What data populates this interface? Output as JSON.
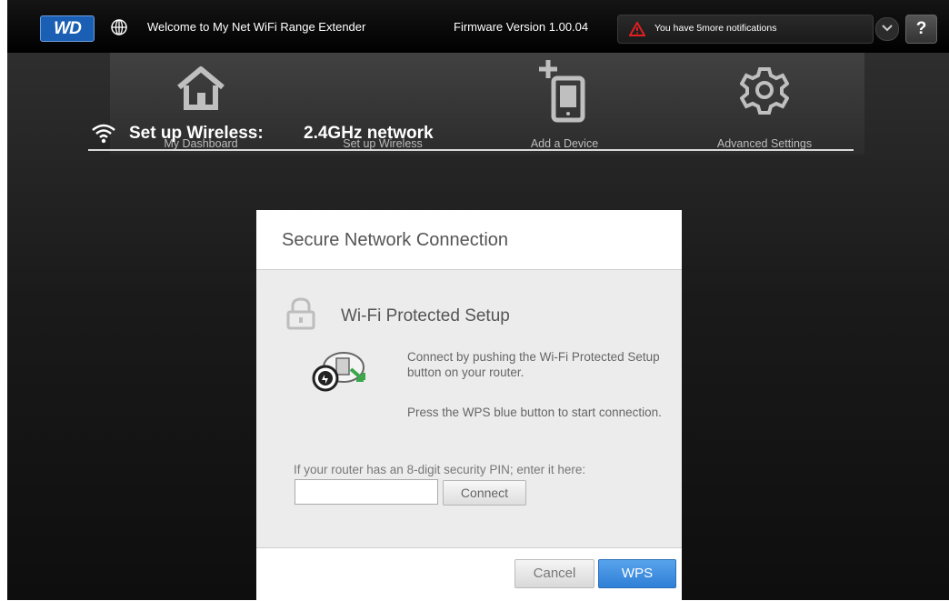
{
  "header": {
    "logo_text": "WD",
    "welcome": "Welcome to My Net WiFi Range Extender",
    "firmware": "Firmware Version 1.00.04",
    "notification": "You have 5more notifications",
    "help_label": "?"
  },
  "nav": {
    "items": [
      {
        "label": "My Dashboard",
        "icon": "home-icon"
      },
      {
        "label": "Set up Wireless",
        "icon": "wireless-icon"
      },
      {
        "label": "Add a Device",
        "icon": "add-device-icon"
      },
      {
        "label": "Advanced Settings",
        "icon": "gear-icon"
      }
    ]
  },
  "section": {
    "title": "Set up Wireless:",
    "subtitle": "2.4GHz network"
  },
  "modal": {
    "title": "Secure Network Connection",
    "heading": "Wi-Fi Protected Setup",
    "desc1": "Connect by pushing the Wi-Fi Protected Setup button on your router.",
    "desc2": "Press the WPS blue button to start connection.",
    "pin_label": "If your router has an 8-digit security PIN; enter it here:",
    "pin_value": "",
    "connect_label": "Connect",
    "cancel_label": "Cancel",
    "wps_label": "WPS"
  },
  "colors": {
    "accent": "#2e7fd6",
    "brand": "#1a5fb4",
    "warning": "#e02020"
  }
}
